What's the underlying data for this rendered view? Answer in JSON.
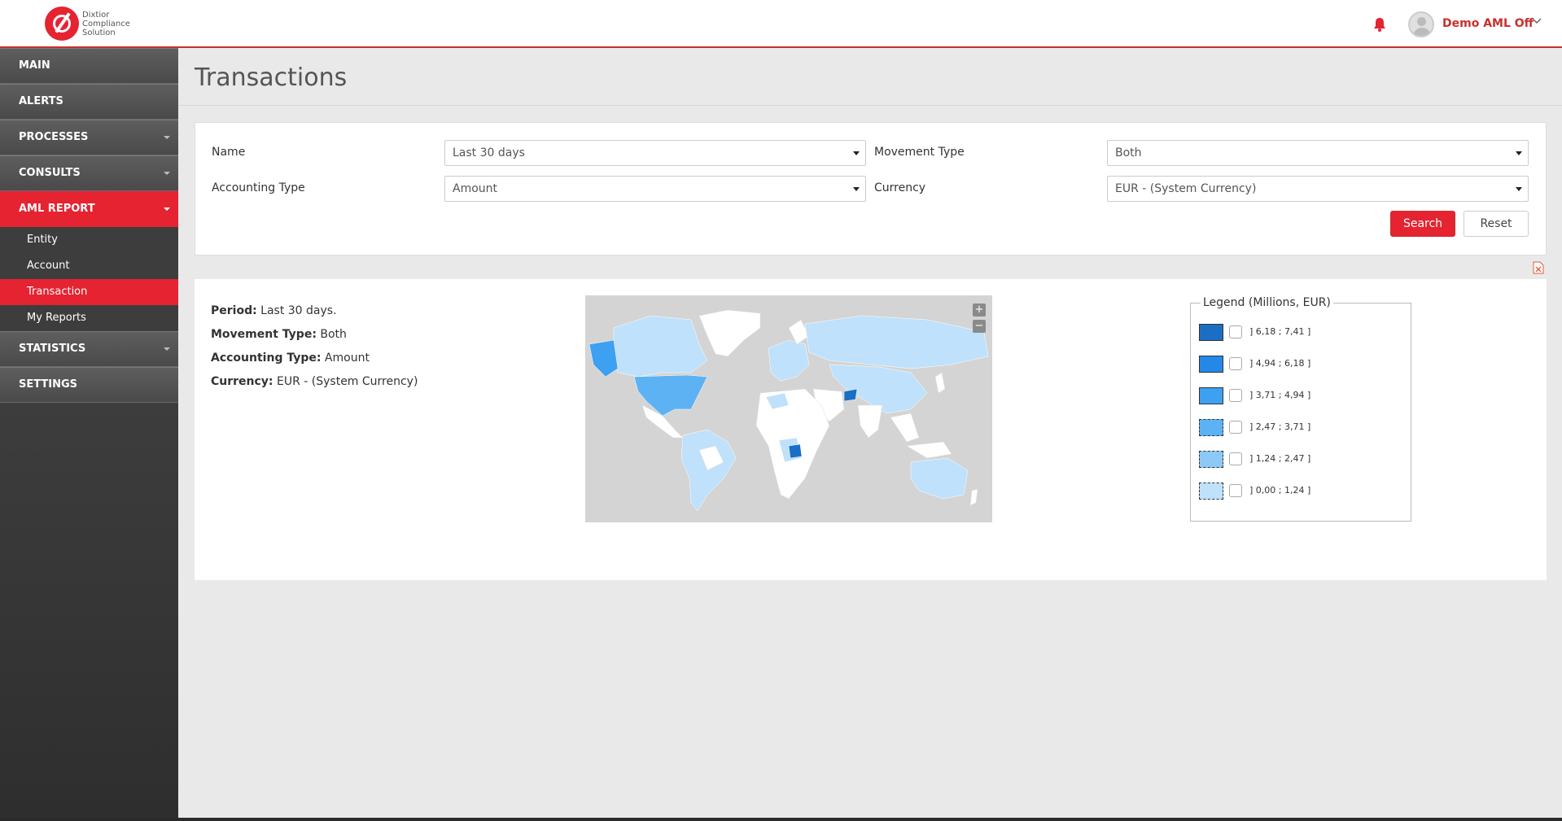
{
  "header": {
    "logo_text": "Dixtior Compliance Solution",
    "user_name": "Demo AML Off"
  },
  "sidebar": {
    "items": [
      {
        "label": "MAIN"
      },
      {
        "label": "ALERTS"
      },
      {
        "label": "PROCESSES"
      },
      {
        "label": "CONSULTS"
      },
      {
        "label": "AML REPORT"
      },
      {
        "label": "STATISTICS"
      },
      {
        "label": "SETTINGS"
      }
    ],
    "aml_sub": [
      {
        "label": "Entity"
      },
      {
        "label": "Account"
      },
      {
        "label": "Transaction"
      },
      {
        "label": "My Reports"
      }
    ]
  },
  "page": {
    "title": "Transactions"
  },
  "filters": {
    "name_label": "Name",
    "name_value": "Last 30 days",
    "movement_label": "Movement Type",
    "movement_value": "Both",
    "accounting_label": "Accounting Type",
    "accounting_value": "Amount",
    "currency_label": "Currency",
    "currency_value": "EUR - (System Currency)",
    "search_label": "Search",
    "reset_label": "Reset"
  },
  "summary": {
    "period_label": "Period:",
    "period_value": "Last 30 days.",
    "movement_label": "Movement Type:",
    "movement_value": "Both",
    "accounting_label": "Accounting Type:",
    "accounting_value": "Amount",
    "currency_label": "Currency:",
    "currency_value": "EUR - (System Currency)"
  },
  "map": {
    "zoom_in": "+",
    "zoom_out": "−"
  },
  "legend": {
    "title": "Legend (Millions, EUR)",
    "rows": [
      {
        "range": "] 6,18 ; 7,41 ]",
        "color": "#1a6fc4"
      },
      {
        "range": "] 4,94 ; 6,18 ]",
        "color": "#2388e8"
      },
      {
        "range": "] 3,71 ; 4,94 ]",
        "color": "#3ea0f0"
      },
      {
        "range": "] 2,47 ; 3,71 ]",
        "color": "#5db2f3"
      },
      {
        "range": "] 1,24 ; 2,47 ]",
        "color": "#8cc9f6"
      },
      {
        "range": "] 0,00 ; 1,24 ]",
        "color": "#bfe1fb"
      }
    ]
  },
  "colors": {
    "brand_red": "#e52331",
    "sidebar_dark": "#3d3d3d"
  }
}
